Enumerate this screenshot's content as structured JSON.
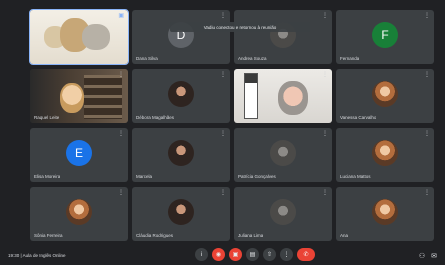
{
  "banner": "Vadiu conectou e retornou à reunião",
  "tiles": [
    {
      "name": "",
      "kind": "scene-1",
      "pin": "▣"
    },
    {
      "name": "Dana Silva",
      "kind": "letter",
      "letter": "D",
      "color": "#5f6368"
    },
    {
      "name": "Andrea Souza",
      "kind": "photo-dog"
    },
    {
      "name": "Fernanda",
      "kind": "letter",
      "letter": "F",
      "color": "#188038"
    },
    {
      "name": "Raquel Leite",
      "kind": "scene-5"
    },
    {
      "name": "Débora Magalhães",
      "kind": "photo-dark"
    },
    {
      "name": "",
      "kind": "scene-7"
    },
    {
      "name": "Vanessa Carvalho",
      "kind": "photo-light"
    },
    {
      "name": "Elisa Moreira",
      "kind": "letter",
      "letter": "E",
      "color": "#1a73e8"
    },
    {
      "name": "Marcela",
      "kind": "photo-dark"
    },
    {
      "name": "Patrícia Gonçalves",
      "kind": "photo-dog"
    },
    {
      "name": "Luciana Mattos",
      "kind": "photo-light"
    },
    {
      "name": "Sônia Ferreira",
      "kind": "photo-light"
    },
    {
      "name": "Cláudia Rodrigues",
      "kind": "photo-dark"
    },
    {
      "name": "Juliana Lima",
      "kind": "photo-dog"
    },
    {
      "name": "Ana",
      "kind": "photo-light"
    }
  ],
  "meeting_info": "19:30   |   Aula de Inglês Online",
  "controls": [
    {
      "icon": "info-icon",
      "glyph": "i"
    },
    {
      "icon": "mic-off-icon",
      "glyph": "◉",
      "red": true
    },
    {
      "icon": "camera-off-icon",
      "glyph": "▣",
      "red": true
    },
    {
      "icon": "captions-icon",
      "glyph": "▤"
    },
    {
      "icon": "present-icon",
      "glyph": "⇧"
    },
    {
      "icon": "more-icon",
      "glyph": "⋮"
    }
  ],
  "leave_glyph": "✆",
  "right": [
    {
      "icon": "people-icon",
      "glyph": "⚇"
    },
    {
      "icon": "chat-icon",
      "glyph": "✉"
    }
  ]
}
